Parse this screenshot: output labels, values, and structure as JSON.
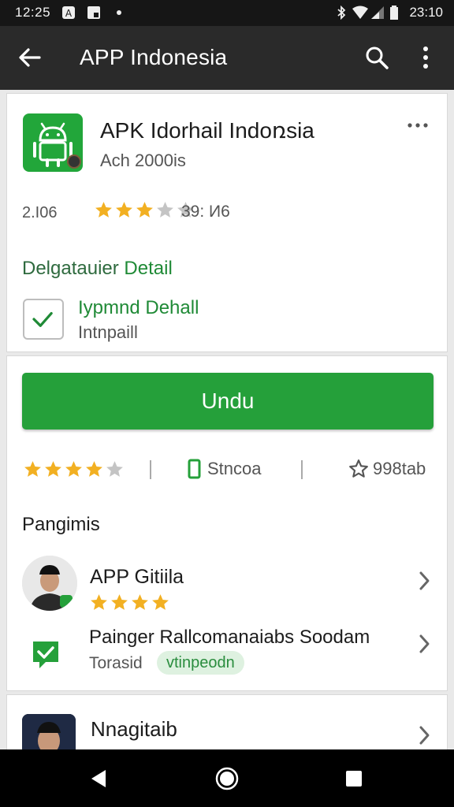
{
  "status_bar": {
    "time": "12:25",
    "right_time": "23:10",
    "icons": [
      "app-notification-icon",
      "download-notification-icon",
      "dot-icon",
      "bluetooth-icon",
      "wifi-icon",
      "signal-icon",
      "battery-icon"
    ]
  },
  "app_bar": {
    "title": "APP Indonesia",
    "icons": [
      "back-arrow-icon",
      "search-icon",
      "overflow-menu-icon"
    ]
  },
  "app_card": {
    "name": "APK Idorhail Indoռsia",
    "subtitle": "Ach 2000is",
    "size": "2.I06",
    "rating_stars": 3,
    "rating_count": "39: И6",
    "detail_link_prefix": "Delgatauier ",
    "detail_link_accent": "Detail",
    "check_title": "Iypmnd Dehall",
    "check_sub": "Intnpaill"
  },
  "install_card": {
    "install_label": "Undu",
    "rating_stars": 4,
    "download_label": "Stncoa",
    "favorite_label": "998tab",
    "section_title": "Pangimis",
    "review1": {
      "name": "APP Gitiila",
      "stars": 4
    },
    "review2": {
      "title": "Painger Rallcomanaiabs Soodam",
      "sub": "Torasid",
      "pill": "vtinpeodn"
    }
  },
  "bottom_card": {
    "name": "Nnagitaib"
  },
  "colors": {
    "accent_green": "#25a03a",
    "star_gold": "#f2b022",
    "app_bar": "#2a2a2a"
  }
}
